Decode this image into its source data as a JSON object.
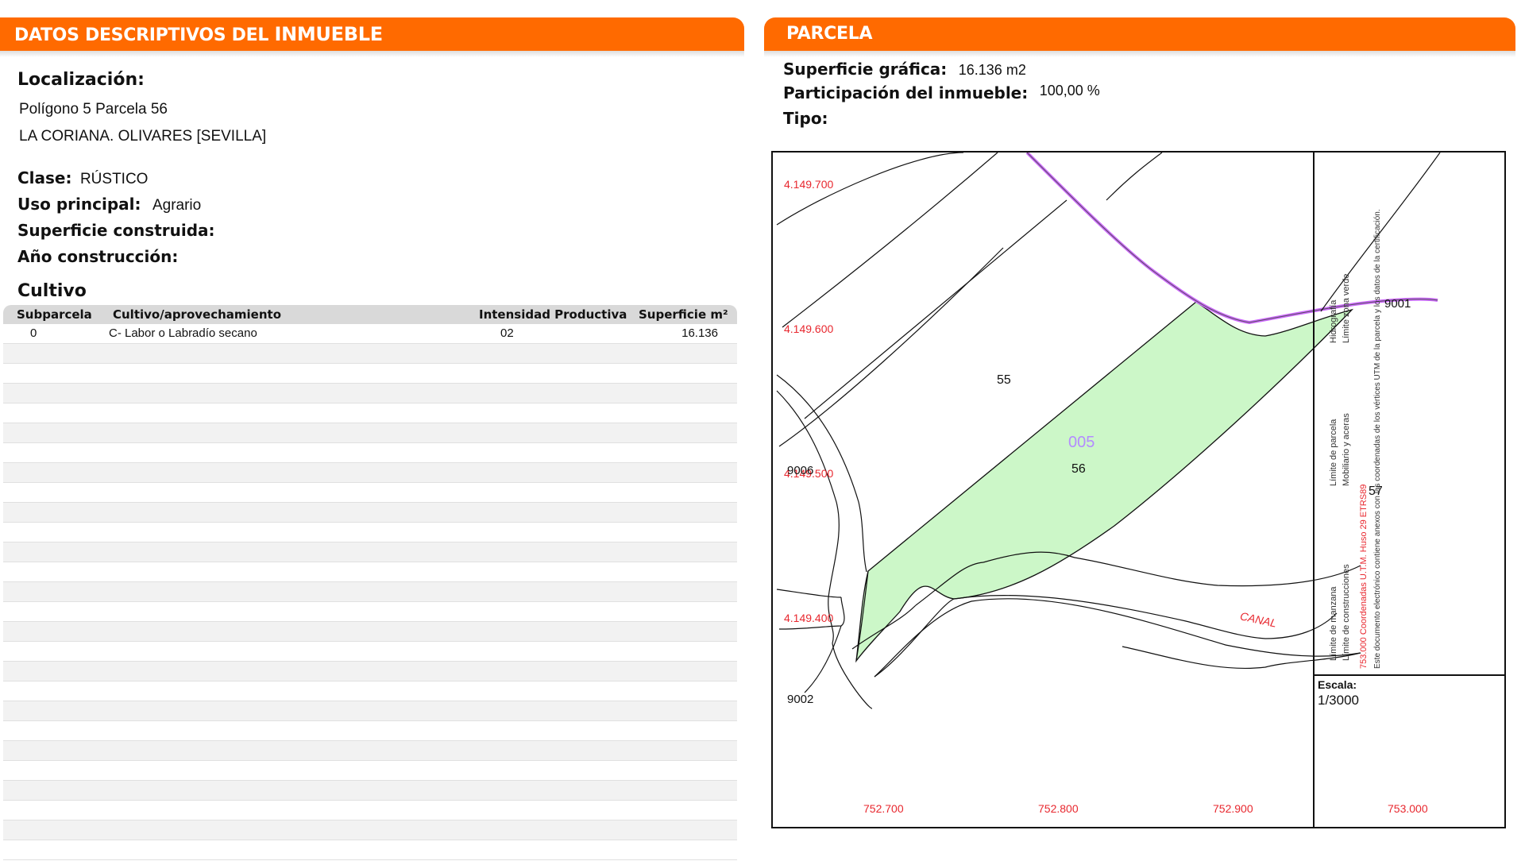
{
  "left_header": {
    "prefix": "DATOS DESCRIPTIVOS DEL ",
    "emphasis": "INMUEBLE"
  },
  "right_header": {
    "title": "PARCELA"
  },
  "localizacion": {
    "label": "Localización:",
    "line1": "Polígono 5 Parcela 56",
    "line2": "LA CORIANA. OLIVARES [SEVILLA]"
  },
  "clase": {
    "label": "Clase:",
    "value": "RÚSTICO"
  },
  "uso": {
    "label": "Uso principal:",
    "value": "Agrario"
  },
  "superficie_construida": {
    "label": "Superficie construida:"
  },
  "anio": {
    "label": "Año construcción:"
  },
  "cultivo": {
    "title": "Cultivo",
    "headers": [
      "Subparcela",
      "Cultivo/aprovechamiento",
      "Intensidad Productiva",
      "Superficie m²"
    ],
    "rows": [
      {
        "subparcela": "0",
        "cultivo": "C- Labor o Labradío secano",
        "intensidad": "02",
        "superficie": "16.136"
      }
    ]
  },
  "parcela": {
    "superficie_label": "Superficie gráfica:",
    "superficie_value": "16.136 m2",
    "participacion_label": "Participación del inmueble:",
    "participacion_value": "100,00 %",
    "tipo_label": "Tipo:"
  },
  "map": {
    "y_coords": [
      "4.149.700",
      "4.149.600",
      "4.149.500",
      "4.149.400"
    ],
    "x_coords": [
      "752.700",
      "752.800",
      "752.900",
      "753.000"
    ],
    "parcel_labels": {
      "p55": "55",
      "p56": "56",
      "p57": "57",
      "sub": "005",
      "r9001": "9001",
      "r9006": "9006",
      "r9002": "9002",
      "canal": "CANAL"
    },
    "scale_label": "Escala:",
    "scale_value": "1/3000",
    "legend": {
      "manzana": "Límite de manzana",
      "parcela": "Límite de parcela",
      "hidrografia": "Hidrografía",
      "construcciones": "Límite de construcciones",
      "mobiliario": "Mobiliario y aceras",
      "zona_verde": "Límite zona verde",
      "coords_note": "753.000 Coordenadas U.T.M. Huso 29 ETRS89",
      "doc_note": "Este documento electrónico contiene anexos con las coordenadas de los vértices UTM de la parcela y los datos de la certificación."
    },
    "colors": {
      "parcel_fill": "#ccf7c8",
      "hydro": "#cc66ff",
      "coord_red": "#e8282f",
      "sub_label": "#b48cff"
    }
  }
}
